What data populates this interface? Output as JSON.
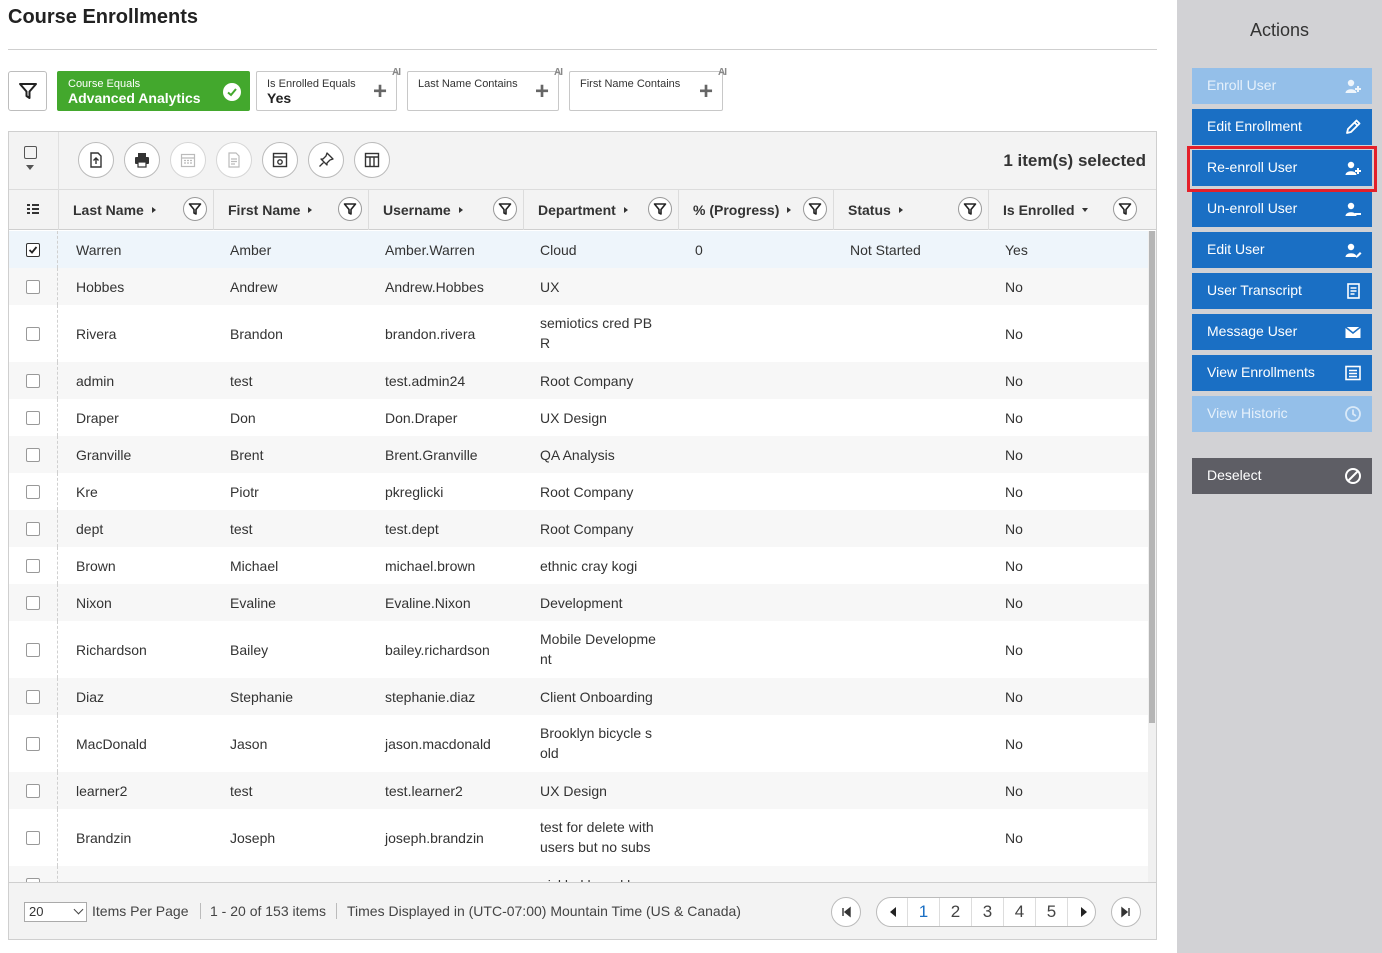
{
  "page": {
    "title": "Course Enrollments"
  },
  "filters": [
    {
      "label": "Course Equals",
      "value": "Advanced Analytics",
      "active": true
    },
    {
      "label": "Is Enrolled Equals",
      "value": "Yes",
      "active": false
    },
    {
      "label": "Last Name Contains",
      "value": "",
      "active": false
    },
    {
      "label": "First Name Contains",
      "value": "",
      "active": false
    }
  ],
  "toolbar": {
    "selected_text": "1 item(s) selected",
    "tools": [
      "export-icon",
      "print-icon",
      "calendar-icon",
      "report-icon",
      "settings-window-icon",
      "pin-icon",
      "columns-icon"
    ]
  },
  "columns": [
    {
      "label": "Last Name",
      "sort": "right"
    },
    {
      "label": "First Name",
      "sort": "right"
    },
    {
      "label": "Username",
      "sort": "right"
    },
    {
      "label": "Department",
      "sort": "right"
    },
    {
      "label": "% (Progress)",
      "sort": "right"
    },
    {
      "label": "Status",
      "sort": "right"
    },
    {
      "label": "Is Enrolled",
      "sort": "down"
    }
  ],
  "rows": [
    {
      "last": "Warren",
      "first": "Amber",
      "user": "Amber.Warren",
      "dept": [
        "Cloud"
      ],
      "progress": "0",
      "status": "Not Started",
      "enrolled": "Yes",
      "checked": true
    },
    {
      "last": "Hobbes",
      "first": "Andrew",
      "user": "Andrew.Hobbes",
      "dept": [
        "UX"
      ],
      "progress": "",
      "status": "",
      "enrolled": "No",
      "checked": false
    },
    {
      "last": "Rivera",
      "first": "Brandon",
      "user": "brandon.rivera",
      "dept": [
        "semiotics cred PB",
        "R"
      ],
      "progress": "",
      "status": "",
      "enrolled": "No",
      "checked": false
    },
    {
      "last": "admin",
      "first": "test",
      "user": "test.admin24",
      "dept": [
        "Root Company"
      ],
      "progress": "",
      "status": "",
      "enrolled": "No",
      "checked": false
    },
    {
      "last": "Draper",
      "first": "Don",
      "user": "Don.Draper",
      "dept": [
        "UX Design"
      ],
      "progress": "",
      "status": "",
      "enrolled": "No",
      "checked": false
    },
    {
      "last": "Granville",
      "first": "Brent",
      "user": "Brent.Granville",
      "dept": [
        "QA Analysis"
      ],
      "progress": "",
      "status": "",
      "enrolled": "No",
      "checked": false
    },
    {
      "last": "Kre",
      "first": "Piotr",
      "user": "pkreglicki",
      "dept": [
        "Root Company"
      ],
      "progress": "",
      "status": "",
      "enrolled": "No",
      "checked": false
    },
    {
      "last": "dept",
      "first": "test",
      "user": "test.dept",
      "dept": [
        "Root Company"
      ],
      "progress": "",
      "status": "",
      "enrolled": "No",
      "checked": false
    },
    {
      "last": "Brown",
      "first": "Michael",
      "user": "michael.brown",
      "dept": [
        "ethnic cray kogi"
      ],
      "progress": "",
      "status": "",
      "enrolled": "No",
      "checked": false
    },
    {
      "last": "Nixon",
      "first": "Evaline",
      "user": "Evaline.Nixon",
      "dept": [
        "Development"
      ],
      "progress": "",
      "status": "",
      "enrolled": "No",
      "checked": false
    },
    {
      "last": "Richardson",
      "first": "Bailey",
      "user": "bailey.richardson",
      "dept": [
        "Mobile Developme",
        "nt"
      ],
      "progress": "",
      "status": "",
      "enrolled": "No",
      "checked": false
    },
    {
      "last": "Diaz",
      "first": "Stephanie",
      "user": "stephanie.diaz",
      "dept": [
        "Client Onboarding"
      ],
      "progress": "",
      "status": "",
      "enrolled": "No",
      "checked": false
    },
    {
      "last": "MacDonald",
      "first": "Jason",
      "user": "jason.macdonald",
      "dept": [
        "Brooklyn bicycle s",
        "old"
      ],
      "progress": "",
      "status": "",
      "enrolled": "No",
      "checked": false
    },
    {
      "last": "learner2",
      "first": "test",
      "user": "test.learner2",
      "dept": [
        "UX Design"
      ],
      "progress": "",
      "status": "",
      "enrolled": "No",
      "checked": false
    },
    {
      "last": "Brandzin",
      "first": "Joseph",
      "user": "joseph.brandzin",
      "dept": [
        "test for delete with",
        "users but no subs"
      ],
      "progress": "",
      "status": "",
      "enrolled": "No",
      "checked": false
    },
    {
      "last": "",
      "first": "",
      "user": "",
      "dept": [
        "pickled beard besp"
      ],
      "progress": "",
      "status": "",
      "enrolled": "",
      "checked": false
    }
  ],
  "footer": {
    "per_page_value": "20",
    "per_page_label": "Items Per Page",
    "range_text": "1 - 20 of 153 items",
    "timezone_text": "Times Displayed in (UTC-07:00) Mountain Time (US & Canada)",
    "pages": [
      "1",
      "2",
      "3",
      "4",
      "5"
    ],
    "current_page": "1"
  },
  "actions": {
    "title": "Actions",
    "buttons": [
      {
        "label": "Enroll User",
        "icon": "user-add-icon",
        "state": "disabled"
      },
      {
        "label": "Edit Enrollment",
        "icon": "pencil-icon",
        "state": "enabled"
      },
      {
        "label": "Re-enroll User",
        "icon": "user-add-icon",
        "state": "enabled",
        "highlighted": true
      },
      {
        "label": "Un-enroll User",
        "icon": "user-remove-icon",
        "state": "enabled"
      },
      {
        "label": "Edit User",
        "icon": "user-edit-icon",
        "state": "enabled"
      },
      {
        "label": "User Transcript",
        "icon": "transcript-icon",
        "state": "enabled"
      },
      {
        "label": "Message User",
        "icon": "envelope-icon",
        "state": "enabled"
      },
      {
        "label": "View Enrollments",
        "icon": "list-icon",
        "state": "enabled"
      },
      {
        "label": "View Historic",
        "icon": "clock-icon",
        "state": "disabled"
      }
    ],
    "deselect_label": "Deselect"
  },
  "colors": {
    "accent": "#1a6fc4",
    "accent_disabled": "#94bfe9",
    "filter_active": "#43a82d",
    "highlight": "#e3202a",
    "panel_bg": "#d2d2d5"
  }
}
